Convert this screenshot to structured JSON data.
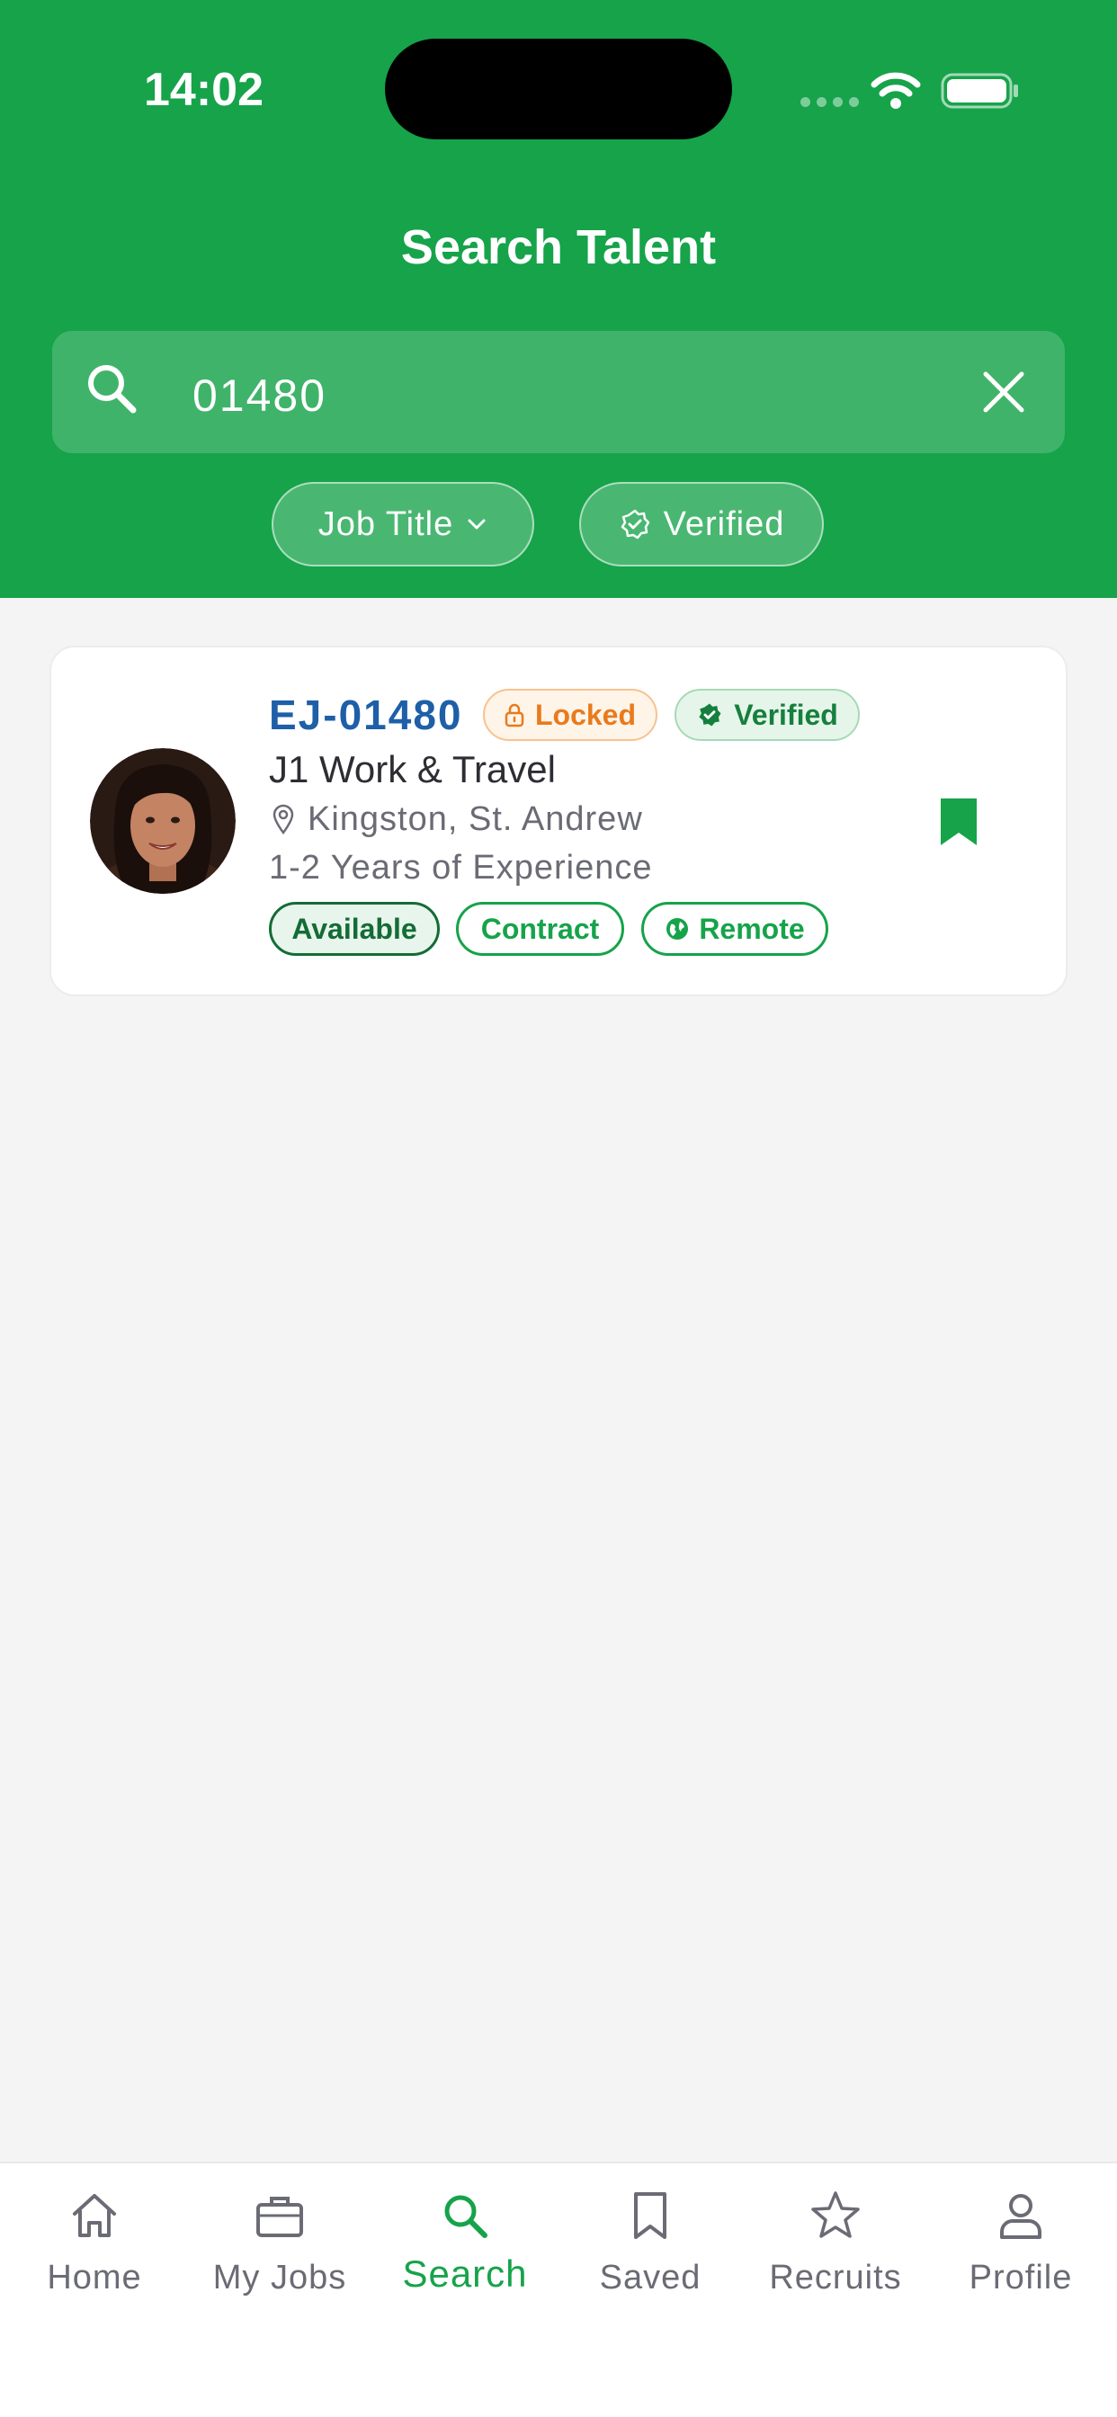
{
  "status_bar": {
    "time": "14:02"
  },
  "header": {
    "title": "Search Talent"
  },
  "search": {
    "value": "01480"
  },
  "filters": [
    {
      "label": "Job Title",
      "icon": "chevron-down-icon"
    },
    {
      "label": "Verified",
      "icon": "verified-badge-icon"
    }
  ],
  "result": {
    "id": "EJ-01480",
    "locked_label": "Locked",
    "verified_label": "Verified",
    "job_title": "J1 Work & Travel",
    "location": "Kingston, St. Andrew",
    "experience": "1-2 Years of Experience",
    "tags": [
      "Available",
      "Contract",
      "Remote"
    ],
    "saved": true
  },
  "nav": [
    {
      "label": "Home",
      "icon": "home-icon",
      "active": false
    },
    {
      "label": "My Jobs",
      "icon": "briefcase-icon",
      "active": false
    },
    {
      "label": "Search",
      "icon": "search-icon",
      "active": true
    },
    {
      "label": "Saved",
      "icon": "bookmark-icon",
      "active": false
    },
    {
      "label": "Recruits",
      "icon": "star-icon",
      "active": false
    },
    {
      "label": "Profile",
      "icon": "person-icon",
      "active": false
    }
  ],
  "colors": {
    "primary": "#16a34a",
    "id_blue": "#1e5fa8",
    "locked_orange": "#e97a1b",
    "background": "#f4f4f5"
  }
}
